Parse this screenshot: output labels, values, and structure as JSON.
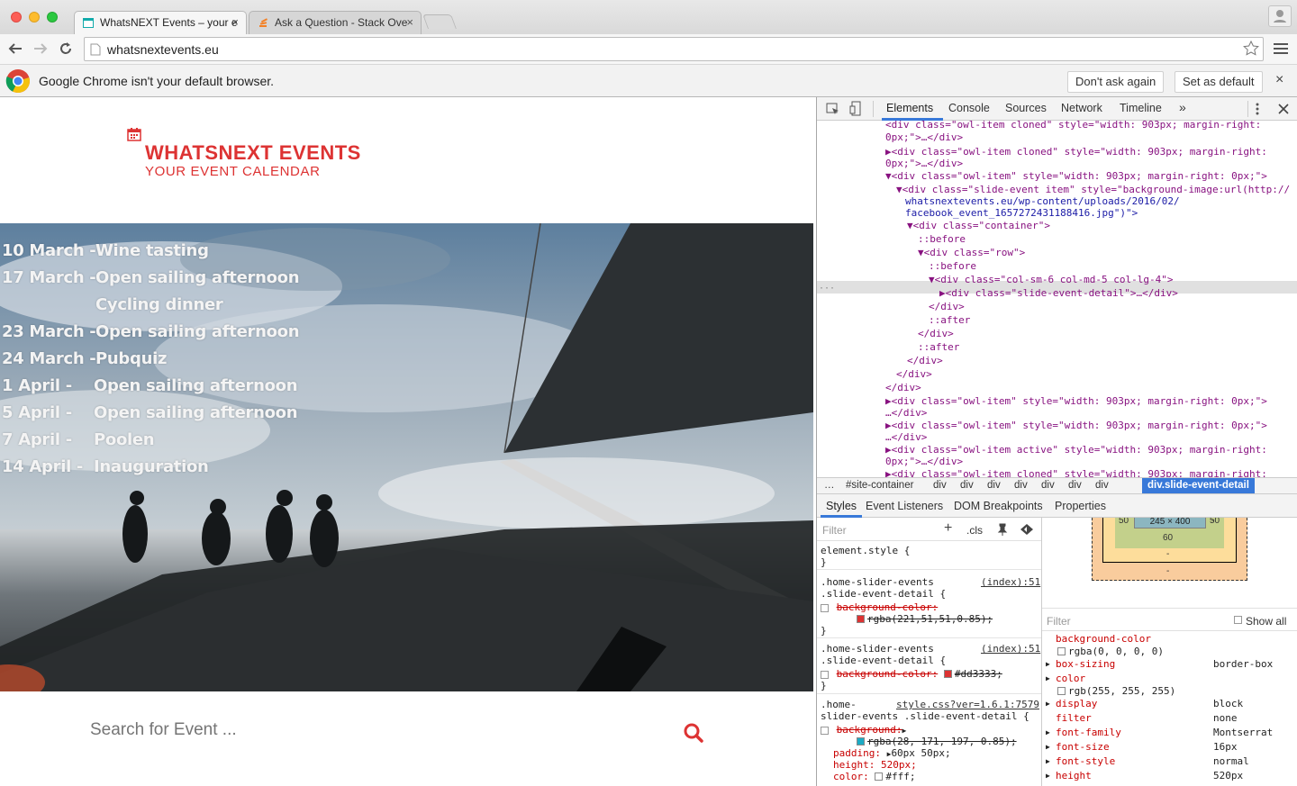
{
  "browser": {
    "tabs": [
      {
        "title": "WhatsNEXT Events – your e",
        "close": "×"
      },
      {
        "title": "Ask a Question - Stack Ove",
        "close": "×"
      }
    ],
    "url": "whatsnextevents.eu",
    "infobar": {
      "message": "Google Chrome isn't your default browser.",
      "dont_ask": "Don't ask again",
      "set_default": "Set as default",
      "close": "×"
    }
  },
  "site": {
    "logo_title": "WHATSNEXT EVENTS",
    "logo_subtitle": "YOUR EVENT CALENDAR",
    "brand_color": "#dd3333",
    "events": [
      {
        "date": "10 March -",
        "name": "Wine tasting"
      },
      {
        "date": "17 March -",
        "name": "Open sailing afternoon"
      },
      {
        "date": "",
        "name": "Cycling dinner"
      },
      {
        "date": "23 March -",
        "name": "Open sailing afternoon"
      },
      {
        "date": "24 March -",
        "name": "Pubquiz"
      },
      {
        "date": "1 April    -",
        "name": "Open sailing afternoon"
      },
      {
        "date": "5 April    -",
        "name": "Open sailing afternoon"
      },
      {
        "date": "7 April    -",
        "name": "Poolen"
      },
      {
        "date": "14 April  -",
        "name": "Inauguration"
      }
    ],
    "search_placeholder": "Search for Event ..."
  },
  "devtools": {
    "tabs": [
      "Elements",
      "Console",
      "Sources",
      "Network",
      "Timeline",
      "»"
    ],
    "active_tab": "Elements",
    "breadcrumbs": [
      "…",
      "#site-container",
      "div",
      "div",
      "div",
      "div",
      "div",
      "div",
      "div",
      "div.slide-event-detail"
    ],
    "styles_tabs": [
      "Styles",
      "Event Listeners",
      "DOM Breakpoints",
      "Properties"
    ],
    "filter_placeholder": "Filter",
    "cls_label": ".cls",
    "show_all": "Show all",
    "box_model": {
      "left": "50",
      "right": "50",
      "content": "245 × 400",
      "padding_bottom": "60",
      "dash1": "-",
      "dash2": "-",
      "dash3": "-"
    },
    "rules": [
      {
        "selector": "element.style {",
        "close": "}"
      },
      {
        "selector": ".home-slider-events",
        "selector2": ".slide-event-detail {",
        "source": "(index):51",
        "prop": "background-color:",
        "value": "rgba(221,51,51,0.85);",
        "close": "}"
      },
      {
        "selector": ".home-slider-events",
        "selector2": ".slide-event-detail {",
        "source": "(index):51",
        "prop": "background-color:",
        "value": "#dd3333;",
        "close": "}"
      },
      {
        "selector": ".home-",
        "selector2": "slider-events .slide-event-detail {",
        "source": "style.css?ver=1.6.1:7579",
        "prop": "background:",
        "value": "rgba(28, 171, 197, 0.85);",
        "padding": "padding: ",
        "padding_val": "60px 50px;",
        "height": "height: 520px;",
        "color": "color: ",
        "color_val": "#fff;"
      }
    ],
    "computed": [
      {
        "name": "background-color",
        "value": "rgba(0, 0, 0, 0)",
        "inline": true
      },
      {
        "name": "box-sizing",
        "value": "border-box"
      },
      {
        "name": "color",
        "value": "rgb(255, 255, 255)",
        "inline": true
      },
      {
        "name": "display",
        "value": "block"
      },
      {
        "name": "filter",
        "value": "none"
      },
      {
        "name": "font-family",
        "value": "Montserrat"
      },
      {
        "name": "font-size",
        "value": "16px"
      },
      {
        "name": "font-style",
        "value": "normal"
      },
      {
        "name": "height",
        "value": "520px"
      }
    ],
    "dom_lines": [
      {
        "text": "<div class=\"owl-item cloned\" style=\"width: 903px; margin-right:",
        "indent": 0
      },
      {
        "text": "0px;\">…</div>",
        "indent": 0
      },
      {
        "text": "▶<div class=\"owl-item cloned\" style=\"width: 903px; margin-right:",
        "indent": 0
      },
      {
        "text": "0px;\">…</div>",
        "indent": 0
      },
      {
        "text": "▼<div class=\"owl-item\" style=\"width: 903px; margin-right: 0px;\">",
        "indent": 0
      },
      {
        "text": "▼<div class=\"slide-event item\" style=\"background-image:url(http://",
        "indent": 1
      },
      {
        "text": "whatsnextevents.eu/wp-content/uploads/2016/02/",
        "indent": 1
      },
      {
        "text": "facebook_event_1657272431188416.jpg\")\">",
        "indent": 1
      },
      {
        "text": "▼<div class=\"container\">",
        "indent": 2
      },
      {
        "text": "::before",
        "indent": 3
      },
      {
        "text": "▼<div class=\"row\">",
        "indent": 3
      },
      {
        "text": "::before",
        "indent": 4
      },
      {
        "text": "▼<div class=\"col-sm-6 col-md-5 col-lg-4\">",
        "indent": 4
      },
      {
        "text": "▶<div class=\"slide-event-detail\">…</div>",
        "indent": 5
      },
      {
        "text": "</div>",
        "indent": 4
      },
      {
        "text": "::after",
        "indent": 4
      },
      {
        "text": "</div>",
        "indent": 3
      },
      {
        "text": "::after",
        "indent": 3
      },
      {
        "text": "</div>",
        "indent": 2
      },
      {
        "text": "</div>",
        "indent": 1
      },
      {
        "text": "</div>",
        "indent": 0
      },
      {
        "text": "▶<div class=\"owl-item\" style=\"width: 903px; margin-right: 0px;\">",
        "indent": 0
      },
      {
        "text": "…</div>",
        "indent": 0
      },
      {
        "text": "▶<div class=\"owl-item\" style=\"width: 903px; margin-right: 0px;\">",
        "indent": 0
      },
      {
        "text": "…</div>",
        "indent": 0
      },
      {
        "text": "▶<div class=\"owl-item active\" style=\"width: 903px; margin-right:",
        "indent": 0
      },
      {
        "text": "0px;\">…</div>",
        "indent": 0
      },
      {
        "text": "▶<div class=\"owl-item cloned\" style=\"width: 903px; margin-right:",
        "indent": 0
      }
    ]
  }
}
